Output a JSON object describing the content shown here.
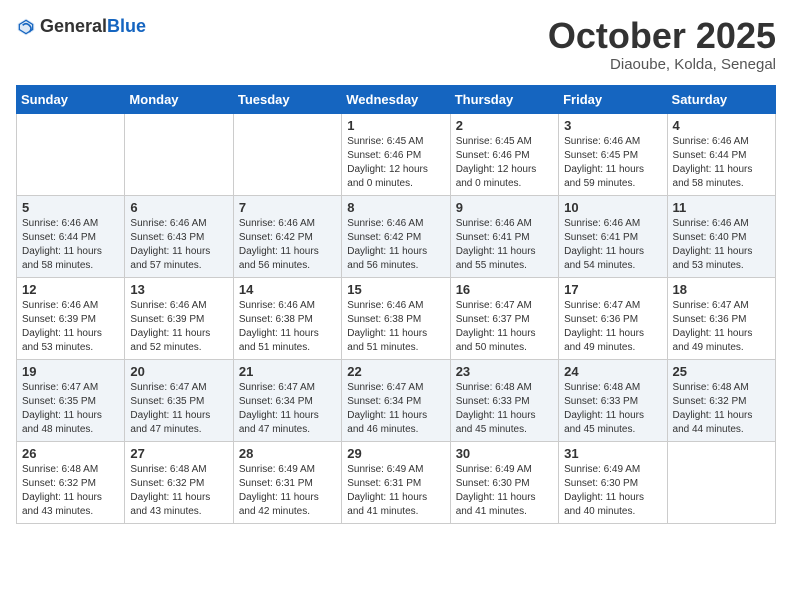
{
  "header": {
    "logo_general": "General",
    "logo_blue": "Blue",
    "month_title": "October 2025",
    "location": "Diaoube, Kolda, Senegal"
  },
  "weekdays": [
    "Sunday",
    "Monday",
    "Tuesday",
    "Wednesday",
    "Thursday",
    "Friday",
    "Saturday"
  ],
  "weeks": [
    [
      {
        "day": "",
        "info": ""
      },
      {
        "day": "",
        "info": ""
      },
      {
        "day": "",
        "info": ""
      },
      {
        "day": "1",
        "info": "Sunrise: 6:45 AM\nSunset: 6:46 PM\nDaylight: 12 hours\nand 0 minutes."
      },
      {
        "day": "2",
        "info": "Sunrise: 6:45 AM\nSunset: 6:46 PM\nDaylight: 12 hours\nand 0 minutes."
      },
      {
        "day": "3",
        "info": "Sunrise: 6:46 AM\nSunset: 6:45 PM\nDaylight: 11 hours\nand 59 minutes."
      },
      {
        "day": "4",
        "info": "Sunrise: 6:46 AM\nSunset: 6:44 PM\nDaylight: 11 hours\nand 58 minutes."
      }
    ],
    [
      {
        "day": "5",
        "info": "Sunrise: 6:46 AM\nSunset: 6:44 PM\nDaylight: 11 hours\nand 58 minutes."
      },
      {
        "day": "6",
        "info": "Sunrise: 6:46 AM\nSunset: 6:43 PM\nDaylight: 11 hours\nand 57 minutes."
      },
      {
        "day": "7",
        "info": "Sunrise: 6:46 AM\nSunset: 6:42 PM\nDaylight: 11 hours\nand 56 minutes."
      },
      {
        "day": "8",
        "info": "Sunrise: 6:46 AM\nSunset: 6:42 PM\nDaylight: 11 hours\nand 56 minutes."
      },
      {
        "day": "9",
        "info": "Sunrise: 6:46 AM\nSunset: 6:41 PM\nDaylight: 11 hours\nand 55 minutes."
      },
      {
        "day": "10",
        "info": "Sunrise: 6:46 AM\nSunset: 6:41 PM\nDaylight: 11 hours\nand 54 minutes."
      },
      {
        "day": "11",
        "info": "Sunrise: 6:46 AM\nSunset: 6:40 PM\nDaylight: 11 hours\nand 53 minutes."
      }
    ],
    [
      {
        "day": "12",
        "info": "Sunrise: 6:46 AM\nSunset: 6:39 PM\nDaylight: 11 hours\nand 53 minutes."
      },
      {
        "day": "13",
        "info": "Sunrise: 6:46 AM\nSunset: 6:39 PM\nDaylight: 11 hours\nand 52 minutes."
      },
      {
        "day": "14",
        "info": "Sunrise: 6:46 AM\nSunset: 6:38 PM\nDaylight: 11 hours\nand 51 minutes."
      },
      {
        "day": "15",
        "info": "Sunrise: 6:46 AM\nSunset: 6:38 PM\nDaylight: 11 hours\nand 51 minutes."
      },
      {
        "day": "16",
        "info": "Sunrise: 6:47 AM\nSunset: 6:37 PM\nDaylight: 11 hours\nand 50 minutes."
      },
      {
        "day": "17",
        "info": "Sunrise: 6:47 AM\nSunset: 6:36 PM\nDaylight: 11 hours\nand 49 minutes."
      },
      {
        "day": "18",
        "info": "Sunrise: 6:47 AM\nSunset: 6:36 PM\nDaylight: 11 hours\nand 49 minutes."
      }
    ],
    [
      {
        "day": "19",
        "info": "Sunrise: 6:47 AM\nSunset: 6:35 PM\nDaylight: 11 hours\nand 48 minutes."
      },
      {
        "day": "20",
        "info": "Sunrise: 6:47 AM\nSunset: 6:35 PM\nDaylight: 11 hours\nand 47 minutes."
      },
      {
        "day": "21",
        "info": "Sunrise: 6:47 AM\nSunset: 6:34 PM\nDaylight: 11 hours\nand 47 minutes."
      },
      {
        "day": "22",
        "info": "Sunrise: 6:47 AM\nSunset: 6:34 PM\nDaylight: 11 hours\nand 46 minutes."
      },
      {
        "day": "23",
        "info": "Sunrise: 6:48 AM\nSunset: 6:33 PM\nDaylight: 11 hours\nand 45 minutes."
      },
      {
        "day": "24",
        "info": "Sunrise: 6:48 AM\nSunset: 6:33 PM\nDaylight: 11 hours\nand 45 minutes."
      },
      {
        "day": "25",
        "info": "Sunrise: 6:48 AM\nSunset: 6:32 PM\nDaylight: 11 hours\nand 44 minutes."
      }
    ],
    [
      {
        "day": "26",
        "info": "Sunrise: 6:48 AM\nSunset: 6:32 PM\nDaylight: 11 hours\nand 43 minutes."
      },
      {
        "day": "27",
        "info": "Sunrise: 6:48 AM\nSunset: 6:32 PM\nDaylight: 11 hours\nand 43 minutes."
      },
      {
        "day": "28",
        "info": "Sunrise: 6:49 AM\nSunset: 6:31 PM\nDaylight: 11 hours\nand 42 minutes."
      },
      {
        "day": "29",
        "info": "Sunrise: 6:49 AM\nSunset: 6:31 PM\nDaylight: 11 hours\nand 41 minutes."
      },
      {
        "day": "30",
        "info": "Sunrise: 6:49 AM\nSunset: 6:30 PM\nDaylight: 11 hours\nand 41 minutes."
      },
      {
        "day": "31",
        "info": "Sunrise: 6:49 AM\nSunset: 6:30 PM\nDaylight: 11 hours\nand 40 minutes."
      },
      {
        "day": "",
        "info": ""
      }
    ]
  ]
}
